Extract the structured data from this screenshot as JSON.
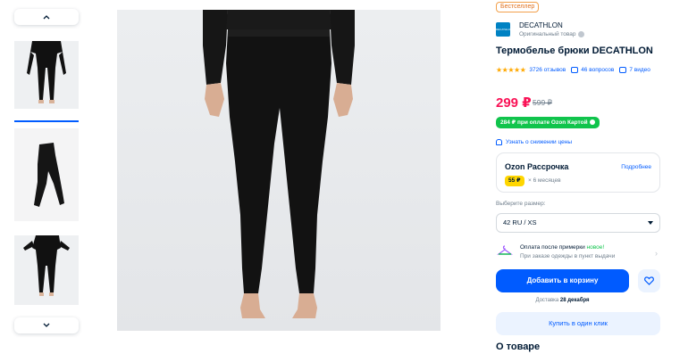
{
  "gallery": {
    "up_icon": "chevron-up-icon",
    "down_icon": "chevron-down-icon",
    "thumbnails": [
      "thumbnail-front",
      "thumbnail-side",
      "thumbnail-back"
    ],
    "active_thumbnail": 0
  },
  "product": {
    "badge": "Бестселлер",
    "brand_logo": "DECATHLON",
    "brand": "DECATHLON",
    "brand_sub": "Оригинальный товар",
    "title": "Термобелье брюки DECATHLON",
    "stars": "★★★★★",
    "reviews": "3726 отзывов",
    "questions": "46 вопросов",
    "videos": "7 видео",
    "price": "299 ₽",
    "old_price": "599 ₽",
    "card_price": "284 ₽ при оплате Ozon Картой",
    "notify": "Узнать о снижении цены"
  },
  "installment": {
    "title": "Ozon Рассрочка",
    "more": "Подробнее",
    "amount": "55 ₽",
    "term": "× 6 месяцев"
  },
  "size": {
    "label": "Выберите размер:",
    "selected": "42 RU / XS"
  },
  "tryon": {
    "line1": "Оплата после примерки",
    "new": "новое!",
    "line2": "При заказе одежды в пункт выдачи"
  },
  "actions": {
    "cart": "Добавить в корзину",
    "delivery_prefix": "Доставка",
    "delivery_date": "28 декабря",
    "oneclick": "Купить в один клик"
  },
  "about": "О товаре",
  "colors": {
    "accent": "#005bff",
    "price": "#f91155",
    "card_green": "#10c44c",
    "installment_yellow": "#ffd600",
    "star": "#ffa800"
  }
}
